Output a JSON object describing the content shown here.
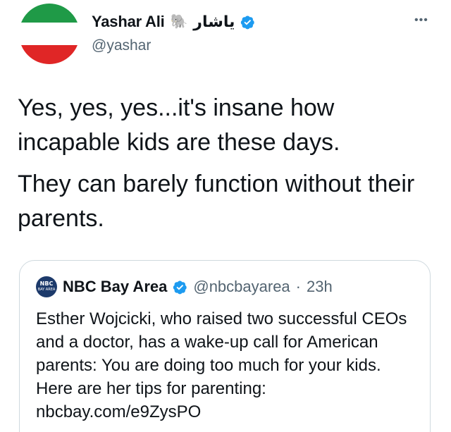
{
  "author": {
    "display_name": "Yashar Ali",
    "emoji": "🐘",
    "name_arabic": "یاشار",
    "handle": "@yashar",
    "avatar_icon": "iran-flag-avatar",
    "verified_color": "#1d9bf0"
  },
  "more_label": "•••",
  "tweet": {
    "paragraphs": [
      "Yes, yes, yes...it's insane how incapable kids are these days.",
      "They can barely function without their parents."
    ]
  },
  "quoted_tweet": {
    "logo_text": "NBC",
    "logo_subtext": "BAY AREA",
    "display_name": "NBC Bay Area",
    "handle": "@nbcbayarea",
    "separator": "·",
    "time": "23h",
    "text": "Esther Wojcicki, who raised two successful CEOs and a doctor, has a wake-up call for American parents: You are doing too much for your kids. Here are her tips for parenting: nbcbay.com/e9ZysPO"
  }
}
